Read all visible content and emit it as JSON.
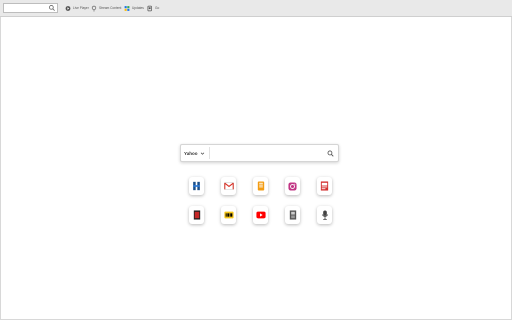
{
  "toolbar": {
    "search": {
      "value": "",
      "placeholder": ""
    },
    "links": [
      {
        "label": "Live Player",
        "icon": "live-player-icon"
      },
      {
        "label": "Stream Content",
        "icon": "stream-icon"
      },
      {
        "label": "Updates",
        "icon": "updates-icon"
      },
      {
        "label": "Go",
        "icon": "go-icon"
      }
    ]
  },
  "search": {
    "engine": "Yahoo",
    "value": "",
    "placeholder": "",
    "button_icon": "search-icon"
  },
  "shortcuts": [
    {
      "icon": "tv-channel-icon",
      "color": "#1b4f8a"
    },
    {
      "icon": "gmail-icon",
      "color": "#d93025"
    },
    {
      "icon": "book-icon",
      "color": "#f39c12"
    },
    {
      "icon": "instagram-icon",
      "color": "#c13584"
    },
    {
      "icon": "news-icon",
      "color": "#d32f2f"
    },
    {
      "icon": "movie-icon",
      "color": "#c62828"
    },
    {
      "icon": "imdb-icon",
      "color": "#f5c518"
    },
    {
      "icon": "youtube-icon",
      "color": "#ff0000"
    },
    {
      "icon": "film-reel-icon",
      "color": "#555555"
    },
    {
      "icon": "podcast-icon",
      "color": "#444444"
    }
  ]
}
